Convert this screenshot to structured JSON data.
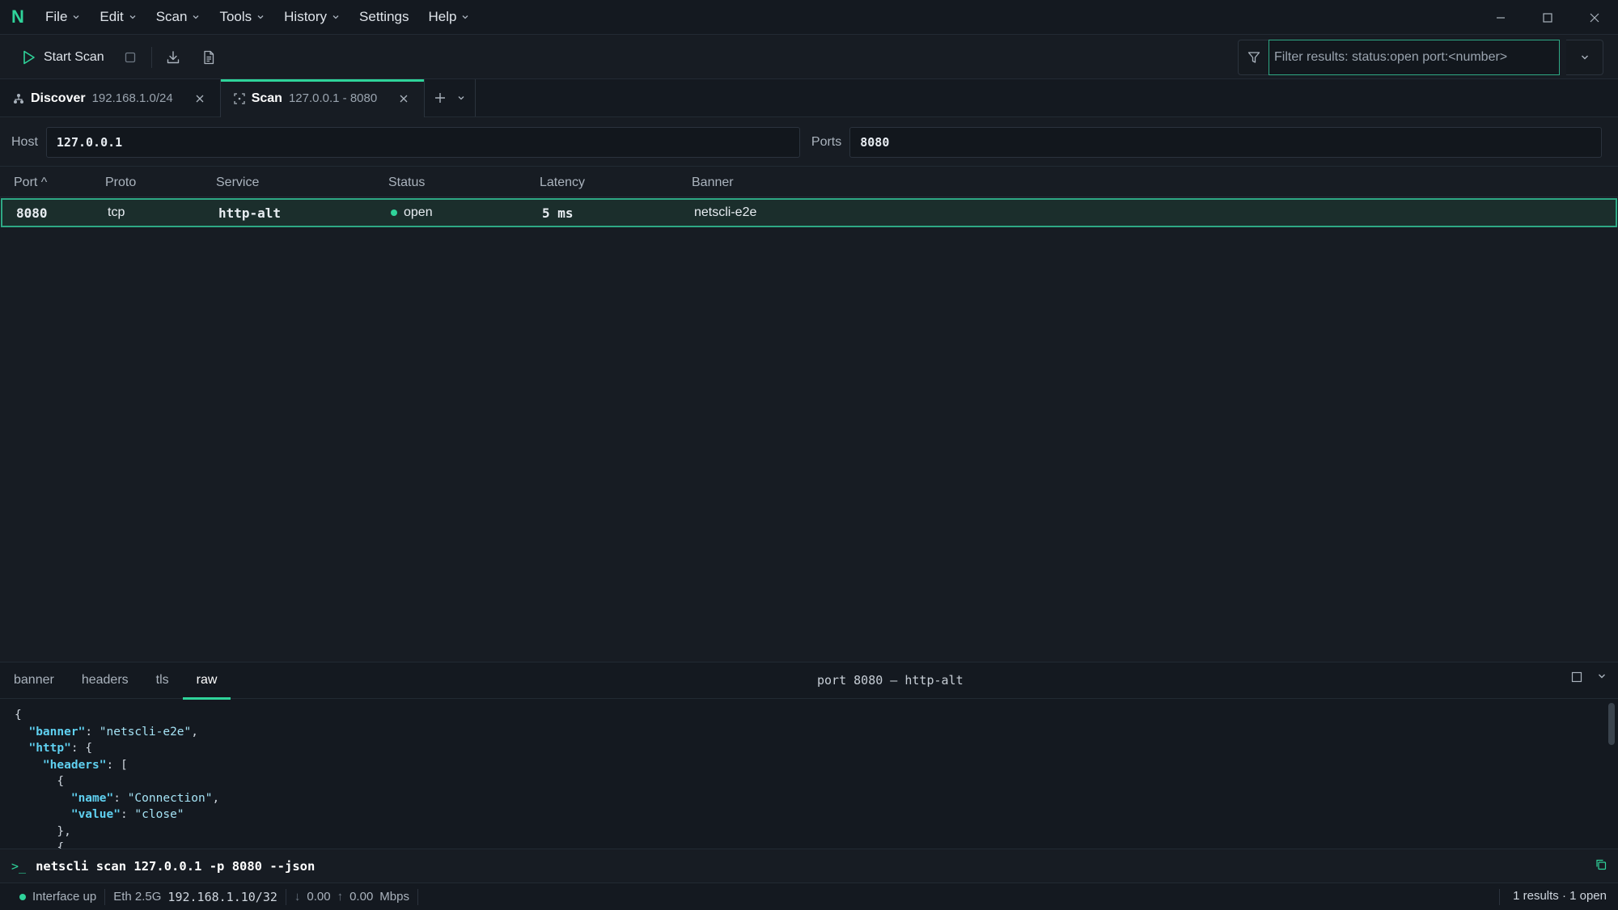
{
  "app": {
    "logo": "N"
  },
  "menu": [
    {
      "label": "File",
      "dropdown": true
    },
    {
      "label": "Edit",
      "dropdown": true
    },
    {
      "label": "Scan",
      "dropdown": true
    },
    {
      "label": "Tools",
      "dropdown": true
    },
    {
      "label": "History",
      "dropdown": true
    },
    {
      "label": "Settings",
      "dropdown": false
    },
    {
      "label": "Help",
      "dropdown": true
    }
  ],
  "toolbar": {
    "start_label": "Start Scan",
    "filter_placeholder": "Filter results: status:open port:<number>"
  },
  "tabs": [
    {
      "name": "Discover",
      "sub": "192.168.1.0/24",
      "icon": "network-icon",
      "active": false
    },
    {
      "name": "Scan",
      "sub": "127.0.0.1 - 8080",
      "icon": "scan-icon",
      "active": true
    }
  ],
  "targets": {
    "host_label": "Host",
    "host_value": "127.0.0.1",
    "ports_label": "Ports",
    "ports_value": "8080"
  },
  "table": {
    "columns": [
      "Port ^",
      "Proto",
      "Service",
      "Status",
      "Latency",
      "Banner"
    ],
    "rows": [
      {
        "port": "8080",
        "proto": "tcp",
        "service": "http-alt",
        "status": "open",
        "latency": "5 ms",
        "banner": "netscli-e2e"
      }
    ]
  },
  "panel": {
    "tabs": [
      "banner",
      "headers",
      "tls",
      "raw"
    ],
    "active_tab": "raw",
    "title": "port 8080 – http-alt",
    "code_lines": [
      "{",
      "  \"banner\": \"netscli-e2e\",",
      "  \"http\": {",
      "    \"headers\": [",
      "      {",
      "        \"name\": \"Connection\",",
      "        \"value\": \"close\"",
      "      },",
      "      {"
    ]
  },
  "command": {
    "prompt": ">_",
    "text": "netscli scan 127.0.0.1 -p 8080 --json"
  },
  "status": {
    "interface": "Interface up",
    "link": "Eth 2.5G",
    "ip": "192.168.1.10/32",
    "down": "0.00",
    "up": "0.00",
    "unit": "Mbps",
    "summary": "1 results · 1 open"
  },
  "colors": {
    "accent": "#2fd39a",
    "background": "#171c23",
    "selected_row": "#1b2e2c"
  }
}
